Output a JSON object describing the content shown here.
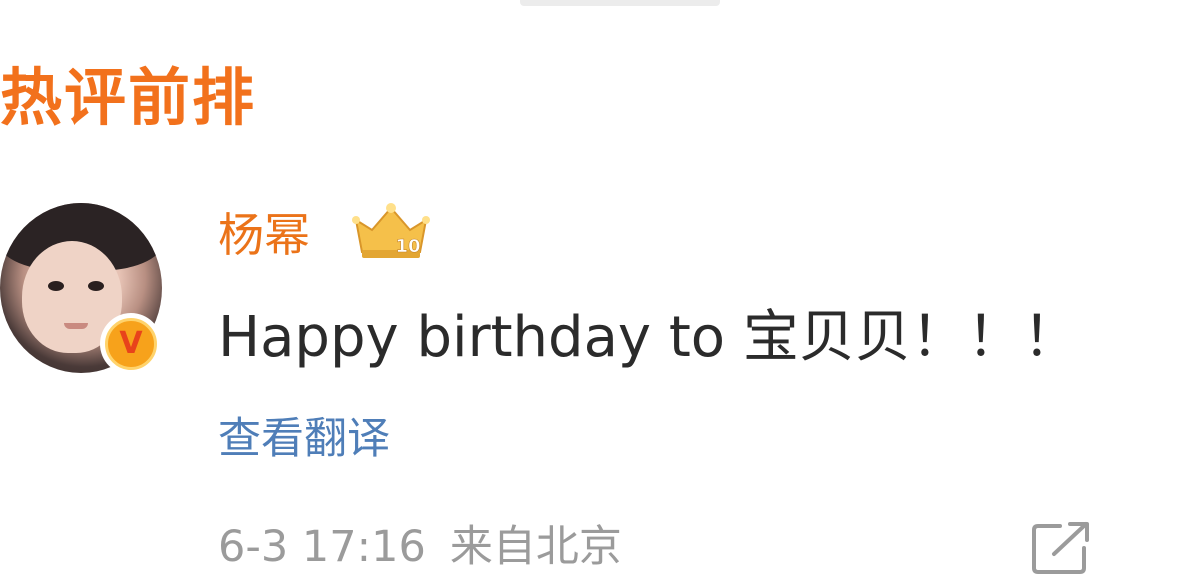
{
  "section": {
    "title": "热评前排"
  },
  "comment": {
    "username": "杨幂",
    "badge_letter": "V",
    "crown_number": "10",
    "text": "Happy birthday to 宝贝贝！！！",
    "translate_label": "查看翻译",
    "timestamp": "6-3 17:16",
    "location": "来自北京"
  },
  "colors": {
    "section_title": "#f2711c",
    "username": "#eb7319",
    "link": "#4f7eb8",
    "meta": "#9b9b9b",
    "text": "#2b2b2b"
  },
  "icons": {
    "crown": "crown-level-icon",
    "verified": "verified-badge-icon",
    "share": "share-icon"
  }
}
